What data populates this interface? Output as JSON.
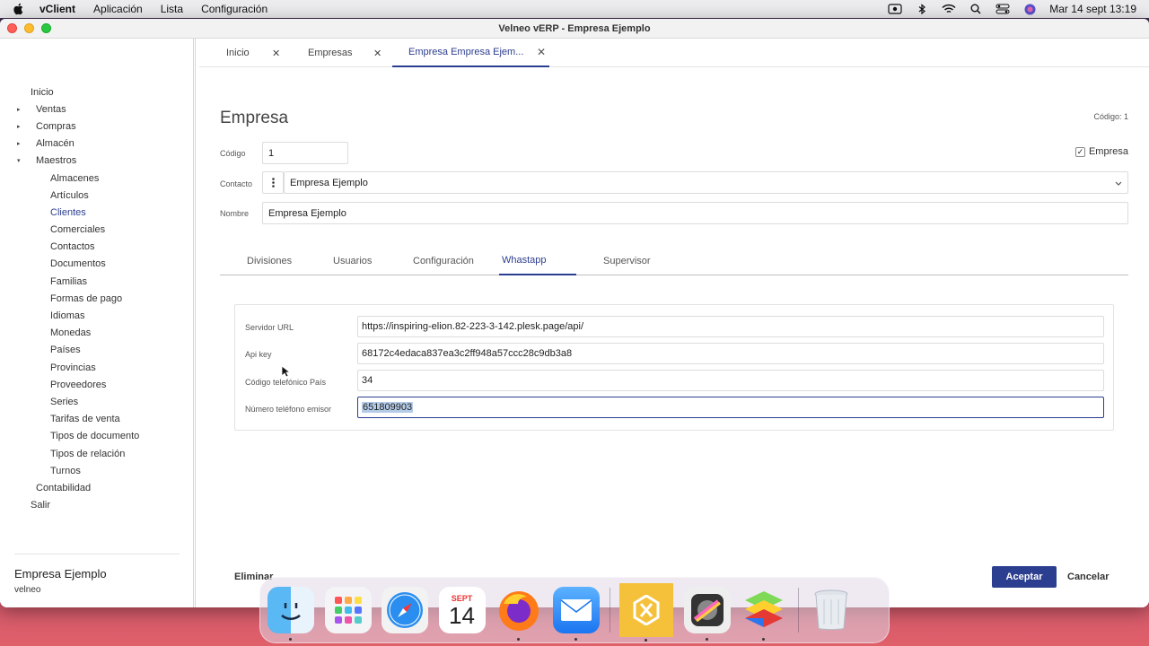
{
  "menubar": {
    "app": "vClient",
    "items": [
      "Aplicación",
      "Lista",
      "Configuración"
    ],
    "clock": "Mar 14 sept  13:19"
  },
  "window": {
    "title": "Velneo vERP - Empresa Ejemplo"
  },
  "sidebar": {
    "items": [
      {
        "label": "Inicio",
        "level": 0
      },
      {
        "label": "Ventas",
        "level": 1,
        "arrow": "▸"
      },
      {
        "label": "Compras",
        "level": 1,
        "arrow": "▸"
      },
      {
        "label": "Almacén",
        "level": 1,
        "arrow": "▸"
      },
      {
        "label": "Maestros",
        "level": 1,
        "arrow": "▾"
      },
      {
        "label": "Almacenes",
        "level": 2
      },
      {
        "label": "Artículos",
        "level": 2
      },
      {
        "label": "Clientes",
        "level": 2,
        "active": true
      },
      {
        "label": "Comerciales",
        "level": 2
      },
      {
        "label": "Contactos",
        "level": 2
      },
      {
        "label": "Documentos",
        "level": 2
      },
      {
        "label": "Familias",
        "level": 2
      },
      {
        "label": "Formas de pago",
        "level": 2
      },
      {
        "label": "Idiomas",
        "level": 2
      },
      {
        "label": "Monedas",
        "level": 2
      },
      {
        "label": "Países",
        "level": 2
      },
      {
        "label": "Provincias",
        "level": 2
      },
      {
        "label": "Proveedores",
        "level": 2
      },
      {
        "label": "Series",
        "level": 2
      },
      {
        "label": "Tarifas de venta",
        "level": 2
      },
      {
        "label": "Tipos de documento",
        "level": 2
      },
      {
        "label": "Tipos de relación",
        "level": 2
      },
      {
        "label": "Turnos",
        "level": 2
      },
      {
        "label": "Contabilidad",
        "level": 1
      },
      {
        "label": "Salir",
        "level": 0
      }
    ],
    "footer": {
      "company": "Empresa Ejemplo",
      "user": "velneo"
    }
  },
  "tabs": [
    {
      "label": "Inicio",
      "close": "✕"
    },
    {
      "label": "Empresas",
      "close": "✕"
    },
    {
      "label": "Empresa Empresa Ejem...",
      "close": "✕",
      "active": true
    }
  ],
  "form": {
    "title": "Empresa",
    "codigo_header": "Código: 1",
    "codigo_label": "Código",
    "codigo_value": "1",
    "empresa_check_label": "Empresa",
    "empresa_checked": "✓",
    "contacto_label": "Contacto",
    "contacto_value": "Empresa Ejemplo",
    "nombre_label": "Nombre",
    "nombre_value": "Empresa Ejemplo"
  },
  "subtabs": [
    {
      "label": "Divisiones"
    },
    {
      "label": "Usuarios"
    },
    {
      "label": "Configuración"
    },
    {
      "label": "Whastapp",
      "active": true
    },
    {
      "label": "Supervisor"
    }
  ],
  "whatsapp": {
    "servidor_label": "Servidor URL",
    "servidor_value": "https://inspiring-elion.82-223-3-142.plesk.page/api/",
    "apikey_label": "Api key",
    "apikey_value": "68172c4edaca837ea3c2ff948a57ccc28c9db3a8",
    "codigo_tel_label": "Código telefónico País",
    "codigo_tel_value": "34",
    "numero_label": "Número teléfono emisor",
    "numero_value": "651809903"
  },
  "buttons": {
    "eliminar": "Eliminar",
    "aceptar": "Aceptar",
    "cancelar": "Cancelar"
  },
  "dock": {
    "calendar_month": "SEPT",
    "calendar_day": "14"
  },
  "colors": {
    "accent": "#2c3e8f"
  }
}
